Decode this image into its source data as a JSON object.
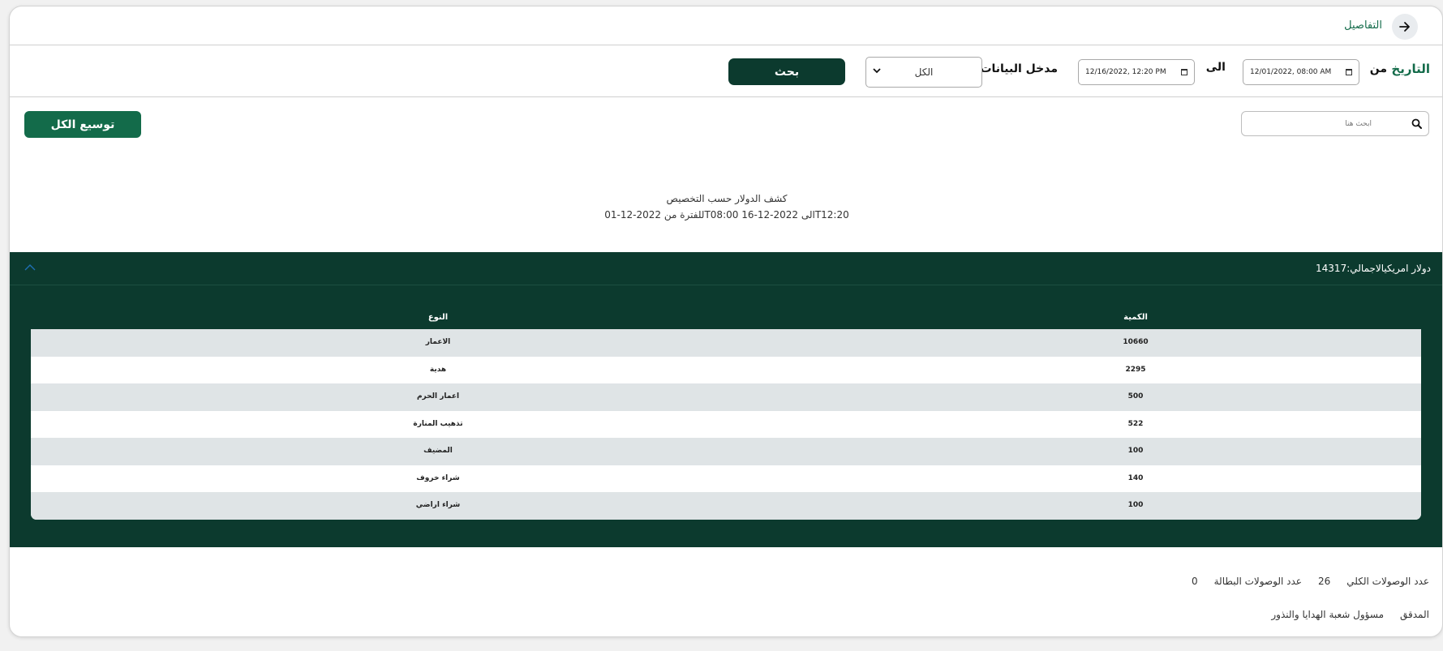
{
  "header": {
    "details_label": "التفاصيل"
  },
  "filters": {
    "date_label": "التاريخ",
    "from_label": "من",
    "from_value": "12/01/2022, 08:00 AM",
    "to_label": "الى",
    "to_value": "12/16/2022, 12:20 PM",
    "entry_label": "مدخل البيانات",
    "entry_selected": "الكل",
    "search_button": "بحث"
  },
  "toolbar": {
    "search_placeholder": "ابحث هنا",
    "expand_all": "توسيع الكل"
  },
  "report": {
    "title": "كشف الدولار حسب التخصيص",
    "period": "للفترة من 2022-12-01T08:00 الى 2022-12-16T12:20"
  },
  "section": {
    "title": "دولار امريكيالاجمالي:14317",
    "columns": {
      "quantity": "الكمية",
      "type": "النوع"
    },
    "rows": [
      {
        "quantity": "10660",
        "type": "الاعمار"
      },
      {
        "quantity": "2295",
        "type": "هدية"
      },
      {
        "quantity": "500",
        "type": "اعمار الحرم"
      },
      {
        "quantity": "522",
        "type": "تذهيب المنارة"
      },
      {
        "quantity": "100",
        "type": "المضيف"
      },
      {
        "quantity": "140",
        "type": "شراء خروف"
      },
      {
        "quantity": "100",
        "type": "شراء اراضي"
      }
    ]
  },
  "footer": {
    "total_receipts_label": "عدد الوصولات الكلي",
    "total_receipts_value": "26",
    "void_receipts_label": "عدد الوصولات البطالة",
    "void_receipts_value": "0",
    "auditor_label": "المدقق",
    "auditor_value": "مسؤول شعبة الهدايا والنذور"
  },
  "colors": {
    "primary_dark": "#0c3a2e",
    "primary": "#136b4a"
  }
}
